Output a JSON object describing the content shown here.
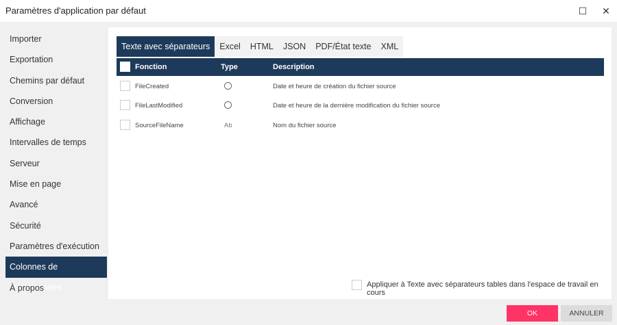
{
  "window": {
    "title": "Paramètres d'application par défaut",
    "maximize_icon": "☐",
    "close_icon": "✕"
  },
  "sidebar": {
    "items": [
      {
        "label": "Importer"
      },
      {
        "label": "Exportation"
      },
      {
        "label": "Chemins par défaut"
      },
      {
        "label": "Conversion"
      },
      {
        "label": "Affichage"
      },
      {
        "label": "Intervalles de temps"
      },
      {
        "label": "Serveur"
      },
      {
        "label": "Mise en page"
      },
      {
        "label": "Avancé"
      },
      {
        "label": "Sécurité"
      },
      {
        "label": "Paramètres d'exécution"
      },
      {
        "label": "Colonnes de métadonnées",
        "active": true
      },
      {
        "label": "À propos"
      }
    ]
  },
  "tabs": [
    {
      "label": "Texte avec séparateurs",
      "active": true
    },
    {
      "label": "Excel"
    },
    {
      "label": "HTML"
    },
    {
      "label": "JSON"
    },
    {
      "label": "PDF/État texte"
    },
    {
      "label": "XML"
    }
  ],
  "table": {
    "headers": {
      "function": "Fonction",
      "type": "Type",
      "description": "Description"
    },
    "rows": [
      {
        "function": "FileCreated",
        "type": "clock-icon",
        "description": "Date et heure de création du fichier source"
      },
      {
        "function": "FileLastModified",
        "type": "clock-icon",
        "description": "Date et heure de la dernière modification du fichier source"
      },
      {
        "function": "SourceFileName",
        "type": "Ab",
        "description": "Nom du fichier source"
      }
    ]
  },
  "apply_label": "Appliquer à Texte avec séparateurs tables dans l'espace de travail en cours",
  "buttons": {
    "ok": "OK",
    "cancel": "ANNULER"
  },
  "colors": {
    "accent": "#1e3a5a",
    "ok": "#ff3366"
  }
}
